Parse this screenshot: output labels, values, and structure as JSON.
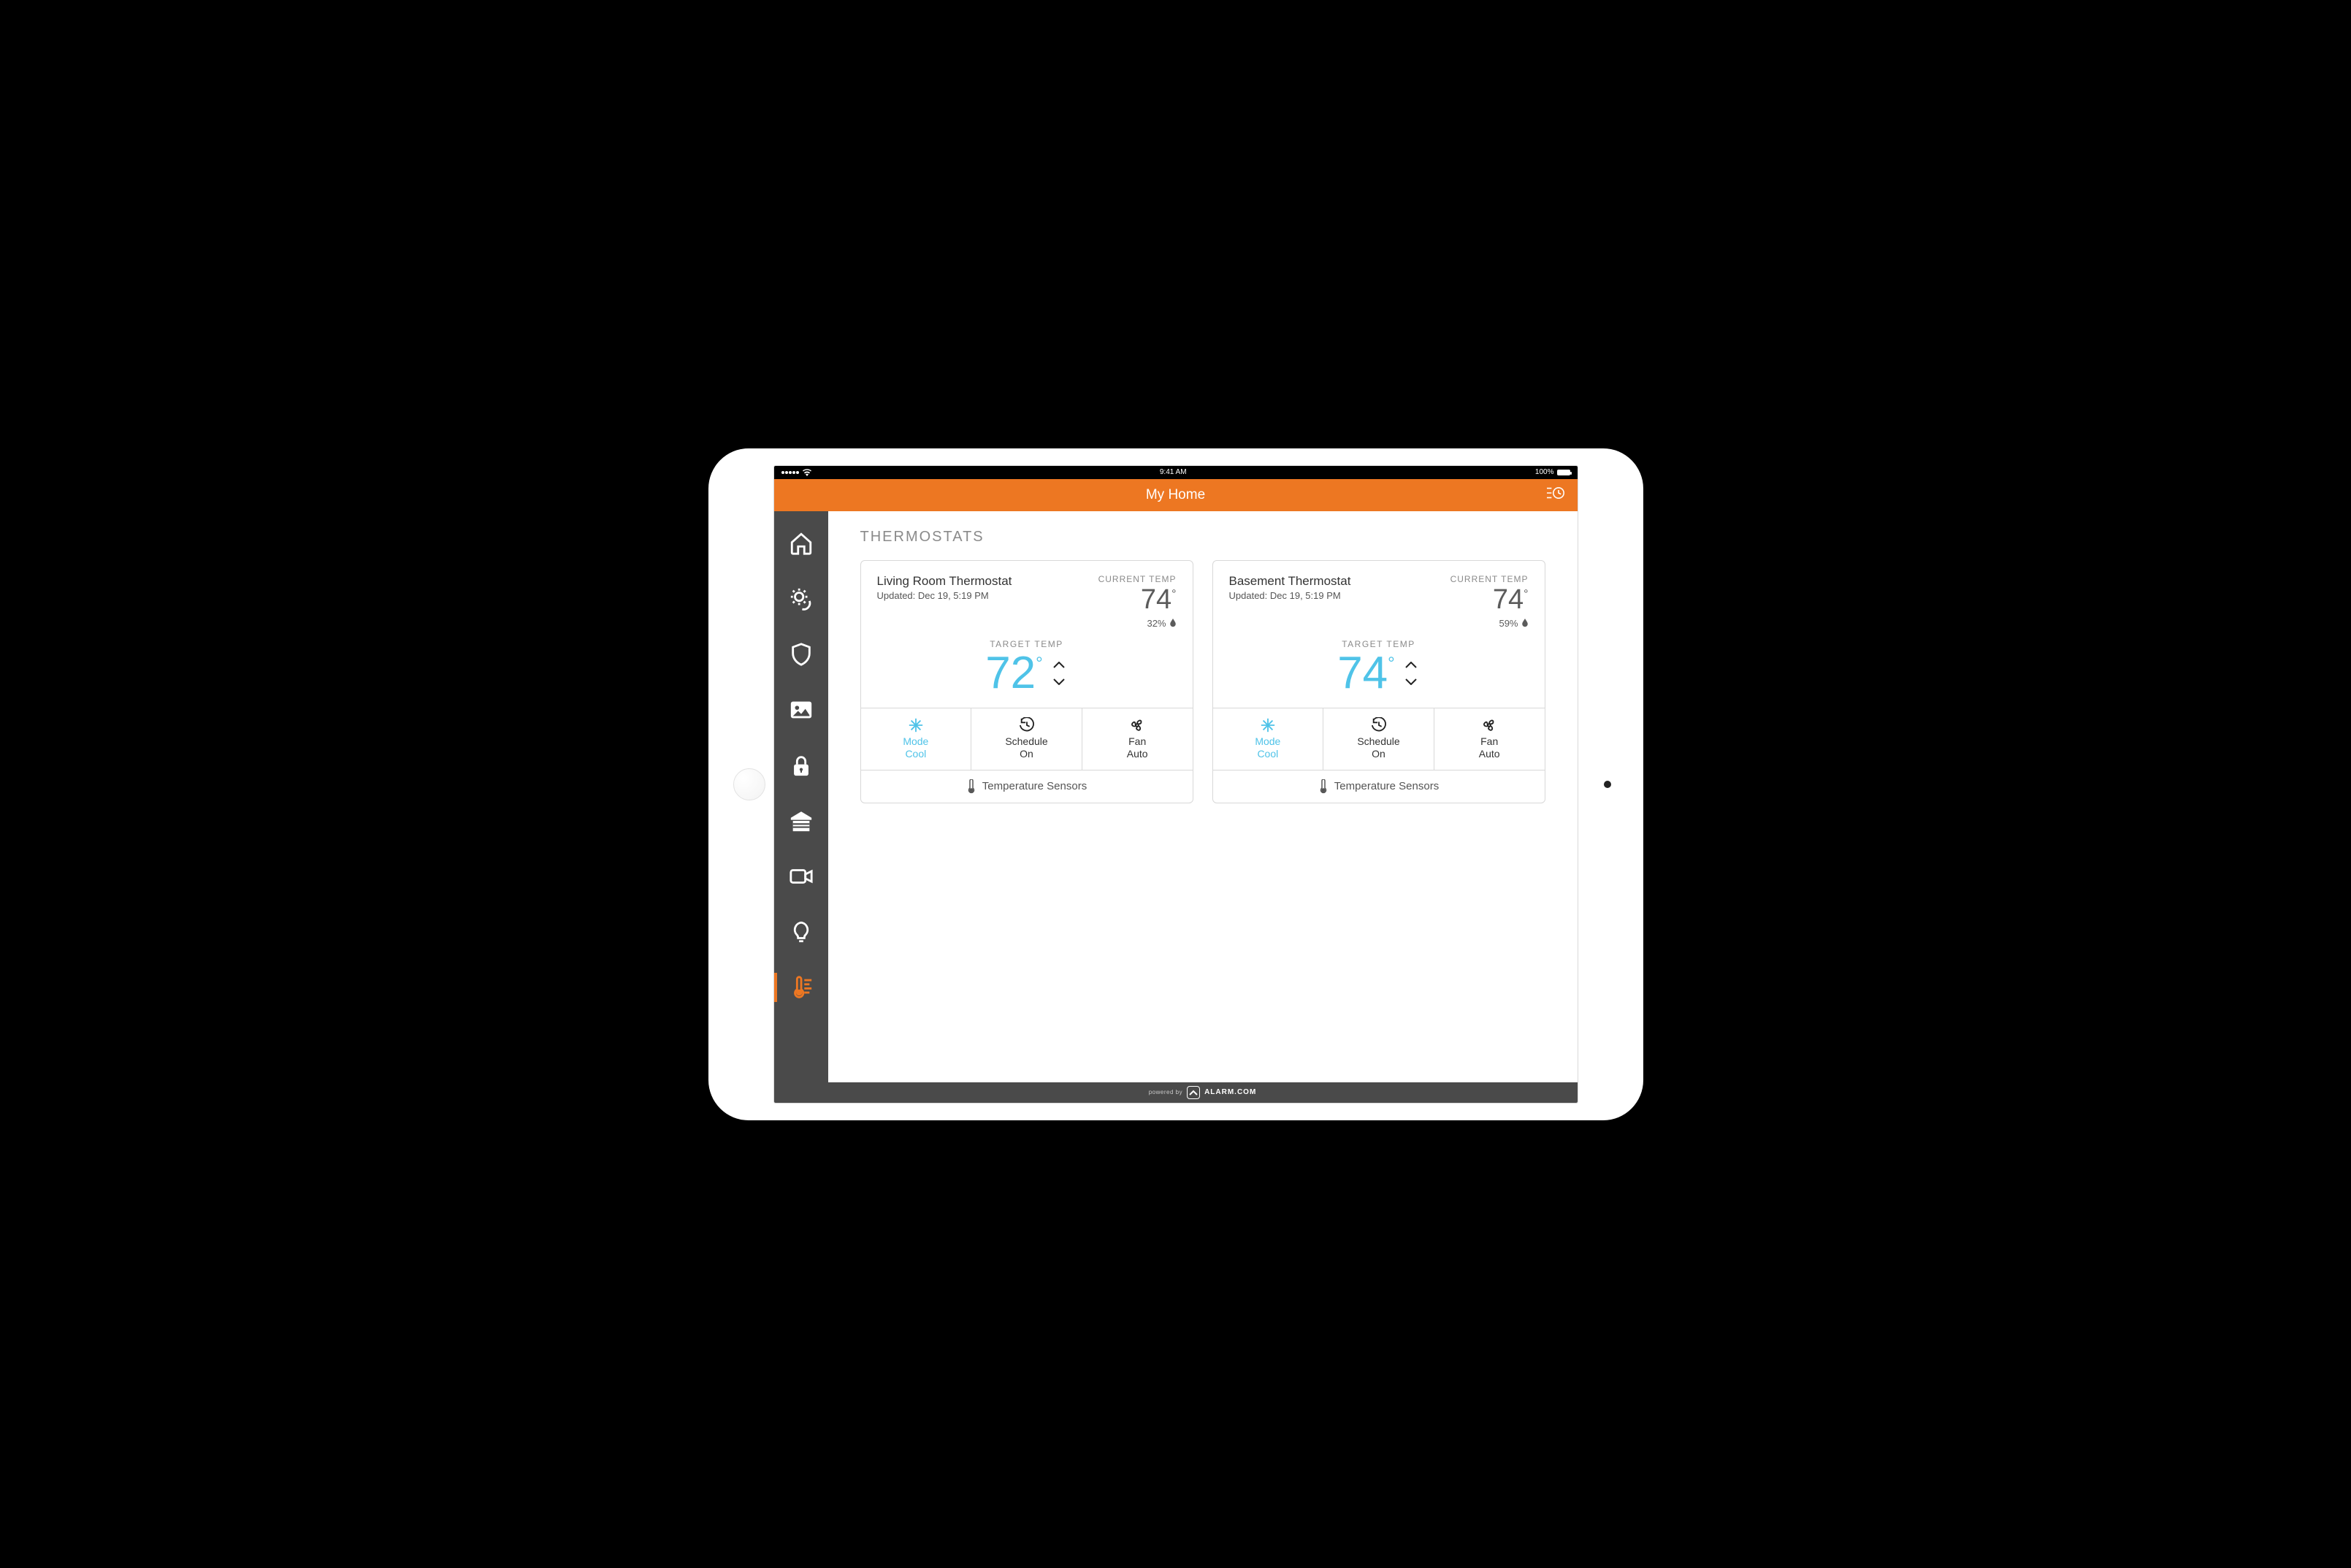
{
  "status": {
    "time": "9:41 AM",
    "battery": "100%"
  },
  "header": {
    "title": "My Home"
  },
  "section_title": "THERMOSTATS",
  "labels": {
    "current": "CURRENT TEMP",
    "target": "TARGET TEMP",
    "mode": "Mode",
    "schedule": "Schedule",
    "fan": "Fan",
    "sensors": "Temperature Sensors",
    "updated_prefix": "Updated: "
  },
  "thermostats": [
    {
      "name": "Living Room Thermostat",
      "updated": "Dec 19, 5:19 PM",
      "current_temp": "74",
      "humidity": "32%",
      "target_temp": "72",
      "mode_value": "Cool",
      "schedule_value": "On",
      "fan_value": "Auto"
    },
    {
      "name": "Basement Thermostat",
      "updated": "Dec 19, 5:19 PM",
      "current_temp": "74",
      "humidity": "59%",
      "target_temp": "74",
      "mode_value": "Cool",
      "schedule_value": "On",
      "fan_value": "Auto"
    }
  ],
  "footer": {
    "powered": "powered by",
    "brand": "ALARM.COM"
  },
  "colors": {
    "accent": "#ED7722",
    "cool": "#4FC3E8",
    "sidebar": "#4A4A4A"
  }
}
